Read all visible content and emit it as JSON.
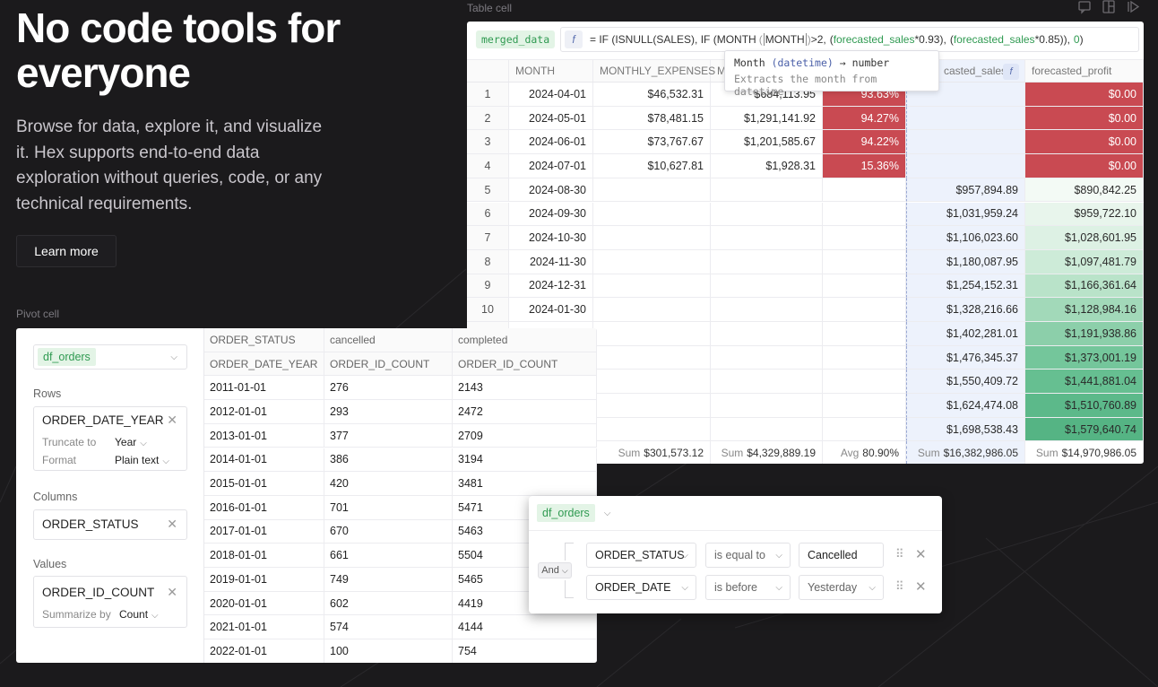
{
  "hero": {
    "title": "No code tools for everyone",
    "body": "Browse for data, explore it, and visualize it. Hex supports end-to-end data exploration without queries, code, or any technical requirements.",
    "learn_more": "Learn more"
  },
  "labels": {
    "table_cell": "Table cell",
    "pivot_cell": "Pivot cell"
  },
  "top_icons": [
    "comment-icon",
    "layout-icon",
    "run-icon"
  ],
  "table": {
    "df_name": "merged_data",
    "formula": {
      "part1": "= IF (ISNULL(SALES), IF (MONTH",
      "fn_arg": "MONTH",
      "part2": ">2,",
      "arg_a": "forecasted_sales",
      "mult_a": "*0.93",
      "sep": "),",
      "arg_b": "forecasted_sales",
      "mult_b": "*0.85",
      "part3": ")),",
      "zero": "0",
      "close": ")"
    },
    "tooltip": {
      "fn": "Month",
      "type": "(datetime)",
      "arrow": "→",
      "ret": "number",
      "desc": "Extracts the month from datetime"
    },
    "columns": [
      "MONTH",
      "MONTHLY_EXPENSES",
      "M",
      "",
      "casted_sales",
      "forecasted_profit"
    ],
    "rows": [
      {
        "i": "1",
        "month": "2024-04-01",
        "exp": "$46,532.31",
        "c3": "$684,113.95",
        "c4": "93.63%",
        "sales": "",
        "profit": "$0.00"
      },
      {
        "i": "2",
        "month": "2024-05-01",
        "exp": "$78,481.15",
        "c3": "$1,291,141.92",
        "c4": "94.27%",
        "sales": "",
        "profit": "$0.00"
      },
      {
        "i": "3",
        "month": "2024-06-01",
        "exp": "$73,767.67",
        "c3": "$1,201,585.67",
        "c4": "94.22%",
        "sales": "",
        "profit": "$0.00"
      },
      {
        "i": "4",
        "month": "2024-07-01",
        "exp": "$10,627.81",
        "c3": "$1,928.31",
        "c4": "15.36%",
        "sales": "",
        "profit": "$0.00"
      },
      {
        "i": "5",
        "month": "2024-08-30",
        "exp": "",
        "c3": "",
        "c4": "",
        "sales": "$957,894.89",
        "profit": "$890,842.25"
      },
      {
        "i": "6",
        "month": "2024-09-30",
        "exp": "",
        "c3": "",
        "c4": "",
        "sales": "$1,031,959.24",
        "profit": "$959,722.10"
      },
      {
        "i": "7",
        "month": "2024-10-30",
        "exp": "",
        "c3": "",
        "c4": "",
        "sales": "$1,106,023.60",
        "profit": "$1,028,601.95"
      },
      {
        "i": "8",
        "month": "2024-11-30",
        "exp": "",
        "c3": "",
        "c4": "",
        "sales": "$1,180,087.95",
        "profit": "$1,097,481.79"
      },
      {
        "i": "9",
        "month": "2024-12-31",
        "exp": "",
        "c3": "",
        "c4": "",
        "sales": "$1,254,152.31",
        "profit": "$1,166,361.64"
      },
      {
        "i": "10",
        "month": "2024-01-30",
        "exp": "",
        "c3": "",
        "c4": "",
        "sales": "$1,328,216.66",
        "profit": "$1,128,984.16"
      },
      {
        "i": "",
        "month": "",
        "exp": "",
        "c3": "",
        "c4": "",
        "sales": "$1,402,281.01",
        "profit": "$1,191,938.86"
      },
      {
        "i": "",
        "month": "",
        "exp": "",
        "c3": "",
        "c4": "",
        "sales": "$1,476,345.37",
        "profit": "$1,373,001.19"
      },
      {
        "i": "",
        "month": "",
        "exp": "",
        "c3": "",
        "c4": "",
        "sales": "$1,550,409.72",
        "profit": "$1,441,881.04"
      },
      {
        "i": "",
        "month": "",
        "exp": "",
        "c3": "",
        "c4": "",
        "sales": "$1,624,474.08",
        "profit": "$1,510,760.89"
      },
      {
        "i": "",
        "month": "",
        "exp": "",
        "c3": "",
        "c4": "",
        "sales": "$1,698,538.43",
        "profit": "$1,579,640.74"
      }
    ],
    "footer": [
      {
        "label": "Sum",
        "value": "$301,573.12"
      },
      {
        "label": "Sum",
        "value": "$4,329,889.19"
      },
      {
        "label": "Avg",
        "value": "80.90%"
      },
      {
        "label": "Sum",
        "value": "$16,382,986.05"
      },
      {
        "label": "Sum",
        "value": "$14,970,986.05"
      }
    ],
    "colors": {
      "red": "#c94a52",
      "green_dark": "#5cbf8e",
      "green_light": "#eef8f2",
      "highlight_col": "#edf2fc"
    }
  },
  "pivot": {
    "df": "df_orders",
    "rows_label": "Rows",
    "row_field": "ORDER_DATE_YEAR",
    "truncate_label": "Truncate to",
    "truncate_value": "Year",
    "format_label": "Format",
    "format_value": "Plain text",
    "columns_label": "Columns",
    "column_field": "ORDER_STATUS",
    "values_label": "Values",
    "value_field": "ORDER_ID_COUNT",
    "summarize_label": "Summarize by",
    "summarize_value": "Count",
    "head1": [
      "ORDER_STATUS",
      "cancelled",
      "completed"
    ],
    "head2": [
      "ORDER_DATE_YEAR",
      "ORDER_ID_COUNT",
      "ORDER_ID_COUNT"
    ],
    "rows": [
      [
        "2011-01-01",
        "276",
        "2143"
      ],
      [
        "2012-01-01",
        "293",
        "2472"
      ],
      [
        "2013-01-01",
        "377",
        "2709"
      ],
      [
        "2014-01-01",
        "386",
        "3194"
      ],
      [
        "2015-01-01",
        "420",
        "3481"
      ],
      [
        "2016-01-01",
        "701",
        "5471"
      ],
      [
        "2017-01-01",
        "670",
        "5463"
      ],
      [
        "2018-01-01",
        "661",
        "5504"
      ],
      [
        "2019-01-01",
        "749",
        "5465"
      ],
      [
        "2020-01-01",
        "602",
        "4419"
      ],
      [
        "2021-01-01",
        "574",
        "4144"
      ],
      [
        "2022-01-01",
        "100",
        "754"
      ]
    ]
  },
  "filter": {
    "df": "df_orders",
    "and": "And",
    "rules": [
      {
        "field": "ORDER_STATUS",
        "op": "is equal to",
        "value": "Cancelled"
      },
      {
        "field": "ORDER_DATE",
        "op": "is before",
        "value": "Yesterday"
      }
    ]
  }
}
